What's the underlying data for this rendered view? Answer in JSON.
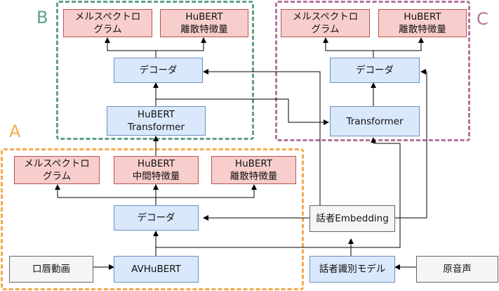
{
  "colors": {
    "group_a": "#f5a94e",
    "group_b": "#5da08a",
    "group_c": "#b5739d",
    "red_fill": "#f8cecc",
    "blue_fill": "#dae8fc",
    "gray_fill": "#f5f5f5"
  },
  "groups": {
    "a": "A",
    "b": "B",
    "c": "C"
  },
  "nodes": {
    "b_mel": "メルスペクトロ\nグラム",
    "b_hubert_disc": "HuBERT\n離散特徴量",
    "b_decoder": "デコーダ",
    "b_transformer": "HuBERT\nTransformer",
    "c_mel": "メルスペクトロ\nグラム",
    "c_hubert_disc": "HuBERT\n離散特徴量",
    "c_decoder": "デコーダ",
    "c_transformer": "Transformer",
    "a_mel": "メルスペクトロ\nグラム",
    "a_hubert_mid": "HuBERT\n中間特徴量",
    "a_hubert_disc": "HuBERT\n離散特徴量",
    "a_decoder": "デコーダ",
    "speaker_embedding": "話者Embedding",
    "lip_video": "口唇動画",
    "avhubert": "AVHuBERT",
    "speaker_model": "話者識別モデル",
    "source_audio": "原音声"
  }
}
